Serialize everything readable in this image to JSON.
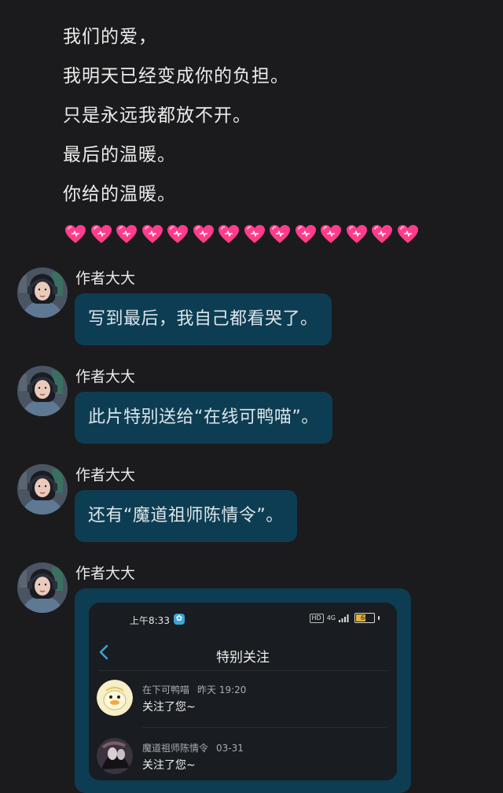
{
  "lyrics": {
    "lines": [
      "我们的爱，",
      "我明天已经变成你的负担。",
      "只是永远我都放不开。",
      "最后的温暖。",
      "你给的温暖。"
    ],
    "hearts": "💓💓💓💓💓💓💓💓💓💓💓💓💓💓"
  },
  "messages": [
    {
      "sender": "作者大大",
      "text": "写到最后，我自己都看哭了。"
    },
    {
      "sender": "作者大大",
      "text": "此片特别送给“在线可鸭喵”。"
    },
    {
      "sender": "作者大大",
      "text": "还有“魔道祖师陈情令”。"
    },
    {
      "sender": "作者大大",
      "text": ""
    }
  ],
  "screenshot": {
    "status_time": "上午8:33",
    "network": "4G",
    "battery": "60",
    "back_icon": "chevron-left-icon",
    "title": "特别关注",
    "items": [
      {
        "name": "在下可鸭喵",
        "time": "昨天 19:20",
        "text": "关注了您~"
      },
      {
        "name": "魔道祖师陈情令",
        "time": "03-31",
        "text": "关注了您~"
      }
    ]
  },
  "colors": {
    "background": "#1b1b1d",
    "bubble": "#0d3d53",
    "accent": "#3da5d8",
    "heart": "#ff3d8b"
  }
}
